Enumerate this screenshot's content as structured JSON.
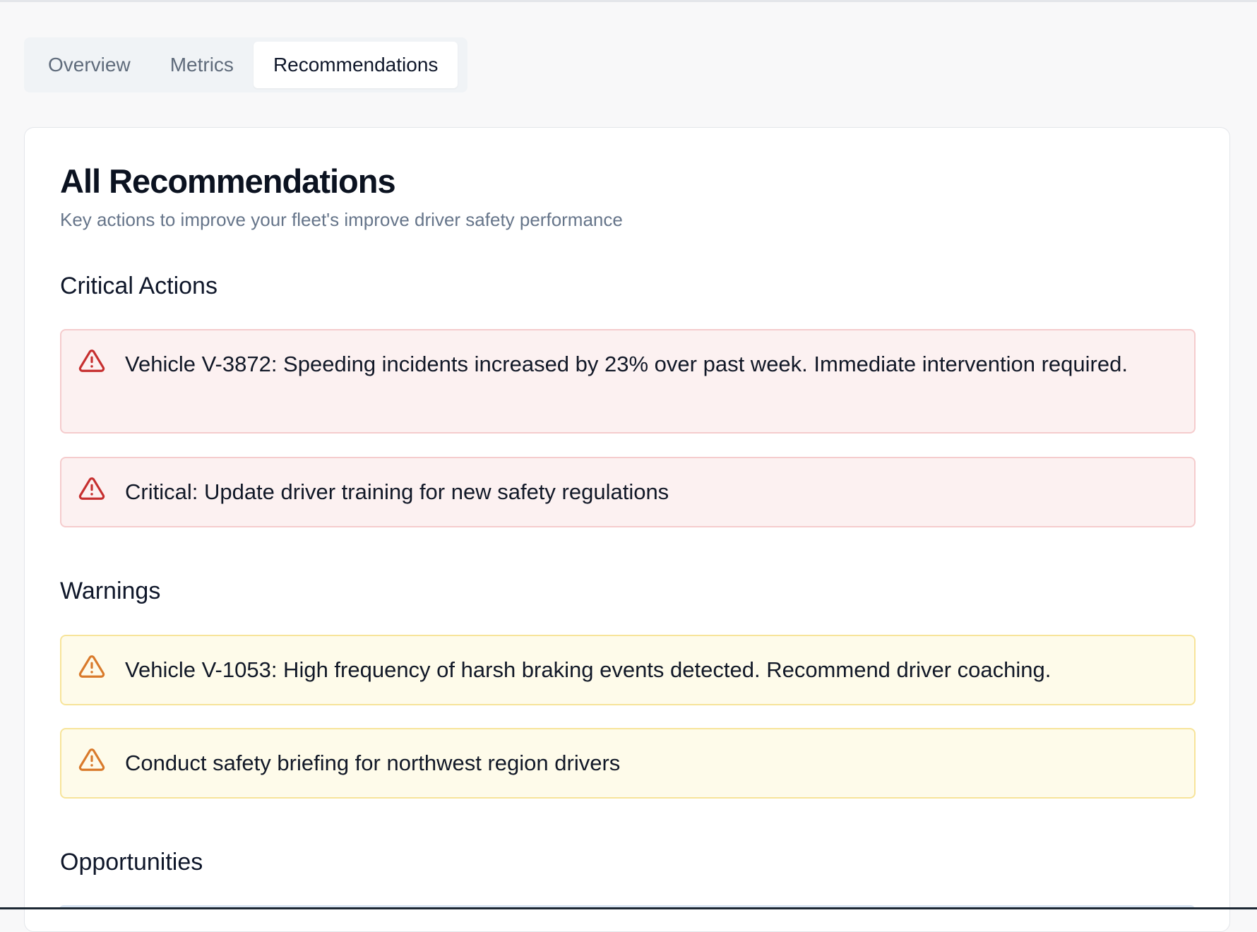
{
  "tabs": [
    {
      "label": "Overview",
      "active": false
    },
    {
      "label": "Metrics",
      "active": false
    },
    {
      "label": "Recommendations",
      "active": true
    }
  ],
  "card": {
    "title": "All Recommendations",
    "subtitle": "Key actions to improve your fleet's improve driver safety performance"
  },
  "sections": {
    "critical": {
      "title": "Critical Actions",
      "items": [
        {
          "icon": "alert-triangle-icon",
          "text": "Vehicle V-3872: Speeding incidents increased by 23% over past week. Immediate intervention required."
        },
        {
          "icon": "alert-triangle-icon",
          "text": "Critical: Update driver training for new safety regulations"
        }
      ]
    },
    "warnings": {
      "title": "Warnings",
      "items": [
        {
          "icon": "alert-triangle-icon",
          "text": "Vehicle V-1053: High frequency of harsh braking events detected. Recommend driver coaching."
        },
        {
          "icon": "alert-triangle-icon",
          "text": "Conduct safety briefing for northwest region drivers"
        }
      ]
    },
    "opportunities": {
      "title": "Opportunities"
    }
  },
  "colors": {
    "critical_icon": "#c62f2f",
    "warning_icon": "#d97a2b",
    "critical_bg": "#fcf1f1",
    "warning_bg": "#fefbea"
  }
}
